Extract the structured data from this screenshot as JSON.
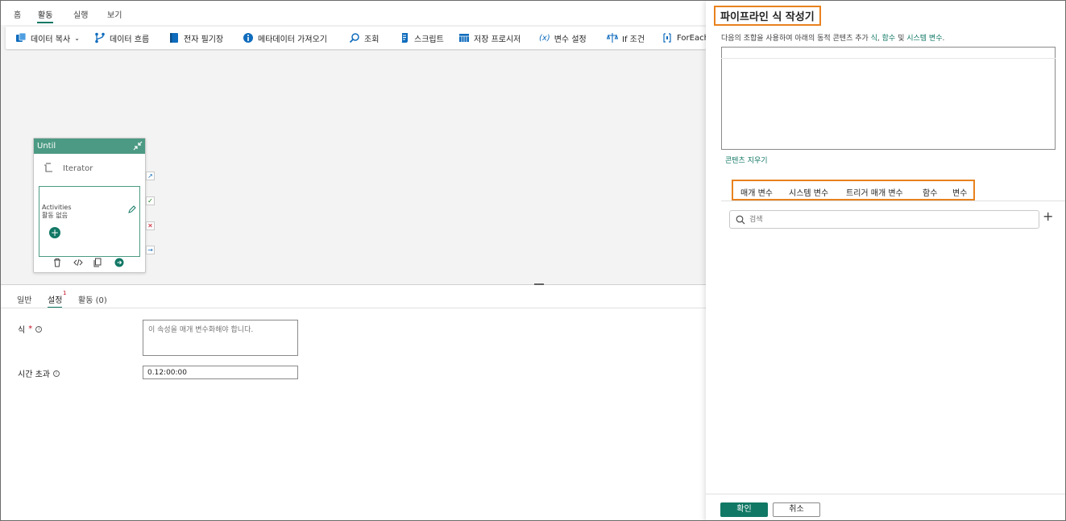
{
  "menu": {
    "tabs": [
      {
        "label": "홈"
      },
      {
        "label": "활동",
        "active": true
      },
      {
        "label": "실행"
      },
      {
        "label": "보기"
      }
    ]
  },
  "toolbar": {
    "items": [
      {
        "label": "데이터 복사",
        "icon": "copy-data-icon",
        "has_dropdown": true
      },
      {
        "label": "데이터 흐름",
        "icon": "dataflow-icon"
      },
      {
        "label": "전자 필기장",
        "icon": "notebook-icon"
      },
      {
        "label": "메타데이터 가져오기",
        "icon": "info-icon"
      },
      {
        "label": "조회",
        "icon": "lookup-icon"
      },
      {
        "label": "스크립트",
        "icon": "script-icon"
      },
      {
        "label": "저장 프로시저",
        "icon": "stored-procedure-icon"
      },
      {
        "label": "변수 설정",
        "icon": "set-variable-icon",
        "glyph": "(x)"
      },
      {
        "label": "If 조건",
        "icon": "if-condition-icon"
      },
      {
        "label": "ForEach",
        "icon": "foreach-icon"
      }
    ]
  },
  "canvas": {
    "until": {
      "title": "Until",
      "iterator_label": "Iterator",
      "activities_title": "Activities",
      "activities_empty": "활동 없음"
    }
  },
  "properties": {
    "tabs": [
      {
        "label": "일반"
      },
      {
        "label": "설정",
        "badge": "1",
        "active": true
      },
      {
        "label": "활동 (0)"
      }
    ],
    "expression": {
      "label": "식",
      "required_mark": "*",
      "placeholder": "이 속성을 매개 변수화해야 합니다."
    },
    "timeout": {
      "label": "시간 초과",
      "value": "0.12:00:00"
    }
  },
  "panel": {
    "title": "파이프라인 식 작성기",
    "description": {
      "prefix": "다음의 조합을 사용하여 아래의 동적 콘텐츠 추가 ",
      "link1": "식",
      "sep1": ", ",
      "link2": "함수",
      "sep2": " 및 ",
      "link3": "시스템 변수",
      "suffix": "."
    },
    "clear_content": "콘텐츠 지우기",
    "tabs": [
      {
        "label": "매개 변수",
        "active": true
      },
      {
        "label": "시스템 변수"
      },
      {
        "label": "트리거 매개 변수"
      },
      {
        "label": "함수"
      },
      {
        "label": "변수"
      }
    ],
    "search_placeholder": "검색",
    "add_symbol": "+",
    "ok_label": "확인",
    "cancel_label": "취소"
  },
  "colors": {
    "accent": "#117865",
    "until_header": "#4c9a83",
    "highlight": "#e8821e"
  }
}
